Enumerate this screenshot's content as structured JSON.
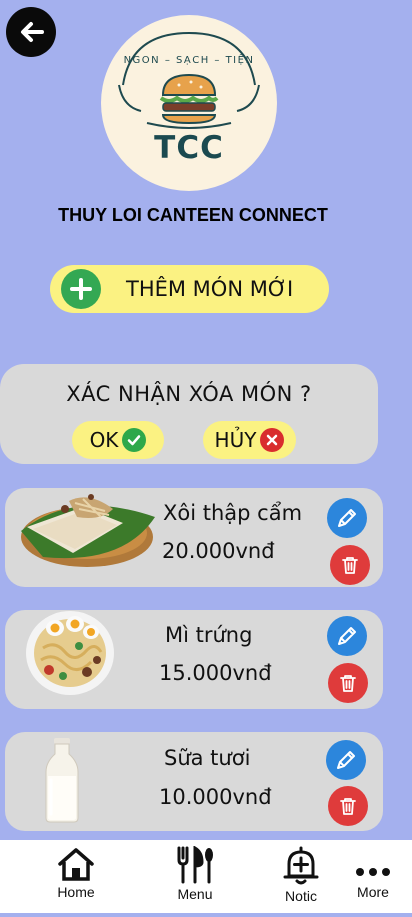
{
  "logo": {
    "tagline": "NGON – SẠCH – TIỆN",
    "text": "TCC"
  },
  "app_title": "THUY LOI CANTEEN CONNECT",
  "add_button": {
    "label": "THÊM MÓN MỚI"
  },
  "confirm_dialog": {
    "question": "XÁC NHẬN XÓA MÓN ?",
    "ok_label": "OK",
    "cancel_label": "HỦY"
  },
  "menu_items": [
    {
      "name": "Xôi thập cẩm",
      "price": "20.000vnđ"
    },
    {
      "name": "Mì trứng",
      "price": "15.000vnđ"
    },
    {
      "name": "Sữa tươi",
      "price": "10.000vnđ"
    }
  ],
  "bottom_nav": {
    "items": [
      {
        "label": "Home",
        "icon": "home-icon"
      },
      {
        "label": "Menu",
        "icon": "utensils-icon"
      },
      {
        "label": "Notic",
        "icon": "bell-plus-icon"
      },
      {
        "label": "More",
        "icon": "more-icon"
      }
    ]
  },
  "colors": {
    "background": "#a4b0ee",
    "accent_yellow": "#fbf282",
    "edit_blue": "#2c86dc",
    "delete_red": "#df3b3b",
    "card_gray": "#d9d9d9",
    "add_green": "#34a853"
  }
}
